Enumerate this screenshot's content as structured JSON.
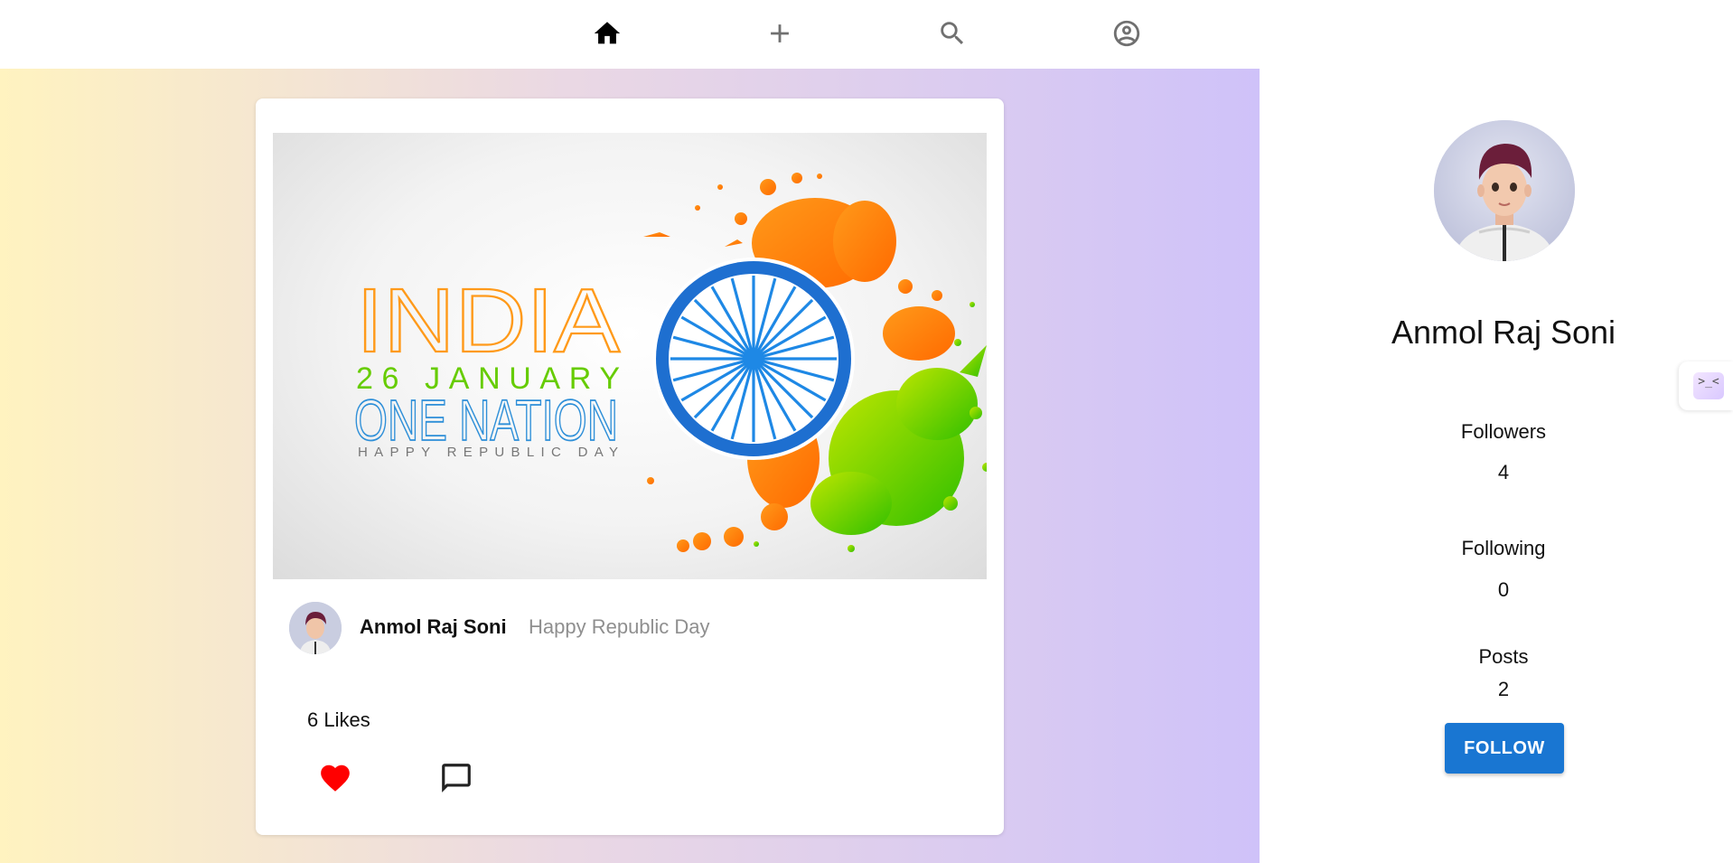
{
  "nav": {
    "items": [
      {
        "name": "home",
        "icon": "home-icon",
        "active": true
      },
      {
        "name": "add",
        "icon": "plus-icon"
      },
      {
        "name": "search",
        "icon": "search-icon"
      },
      {
        "name": "profile",
        "icon": "account-circle-icon"
      }
    ]
  },
  "post": {
    "image": {
      "title": "INDIA",
      "date_line": "26 JANUARY",
      "headline": "ONE NATION",
      "tagline": "HAPPY REPUBLIC DAY",
      "emblem": "ashoka-chakra-icon"
    },
    "author": "Anmol Raj Soni",
    "caption": "Happy Republic Day",
    "likes_label": "6 Likes",
    "liked": true
  },
  "profile": {
    "name": "Anmol Raj Soni",
    "followers_label": "Followers",
    "followers": "4",
    "following_label": "Following",
    "following": "0",
    "posts_label": "Posts",
    "posts": "2",
    "follow_button": "FOLLOW"
  },
  "side_tab": {
    "glyph": ">_<"
  },
  "colors": {
    "accent": "#1976d2",
    "like": "#ff0000",
    "saffron": "#ff8c00",
    "green": "#66cc00",
    "chakra": "#1e88e5"
  }
}
